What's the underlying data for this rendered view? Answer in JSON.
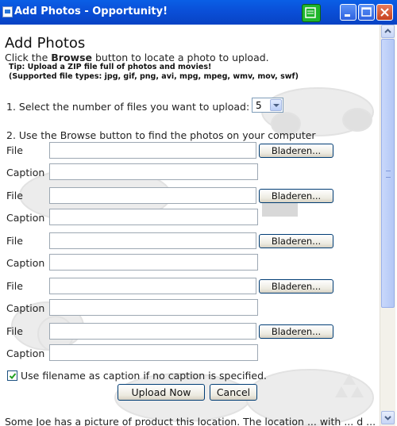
{
  "window": {
    "title": "Add Photos - Opportunity!"
  },
  "page": {
    "heading": "Add Photos",
    "intro_prefix": "Click the ",
    "intro_bold": "Browse",
    "intro_suffix": " button to locate a photo to upload.",
    "tip_line1": "Tip: Upload a ZIP file full of photos and movies!",
    "tip_line2": "(Supported file types: jpg, gif, png, avi, mpg, mpeg, wmv, mov, swf)",
    "step1_label": "1. Select the number of files you want to upload:",
    "file_count": "5",
    "step2_label": "2. Use the Browse button to find the photos on your computer",
    "rows": [
      {
        "file_label": "File",
        "browse_label": "Bladeren...",
        "caption_label": "Caption",
        "file_value": "",
        "caption_value": ""
      },
      {
        "file_label": "File",
        "browse_label": "Bladeren...",
        "caption_label": "Caption",
        "file_value": "",
        "caption_value": ""
      },
      {
        "file_label": "File",
        "browse_label": "Bladeren...",
        "caption_label": "Caption",
        "file_value": "",
        "caption_value": ""
      },
      {
        "file_label": "File",
        "browse_label": "Bladeren...",
        "caption_label": "Caption",
        "file_value": "",
        "caption_value": ""
      },
      {
        "file_label": "File",
        "browse_label": "Bladeren...",
        "caption_label": "Caption",
        "file_value": "",
        "caption_value": ""
      }
    ],
    "checkbox_label": "Use filename as caption if no caption is specified.",
    "checkbox_checked": true,
    "upload_label": "Upload Now",
    "cancel_label": "Cancel",
    "cut_off_text": "Some Joe has a picture of product this location. The location ... with ... d ..."
  },
  "colors": {
    "titlebar": "#0a4fd8",
    "button_border": "#003c74"
  }
}
